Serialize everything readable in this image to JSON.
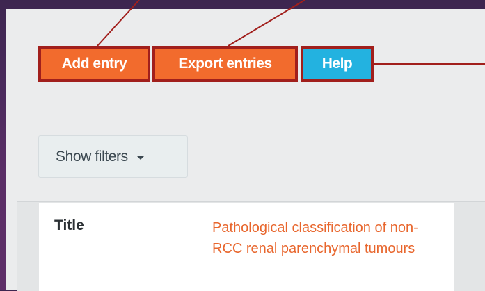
{
  "toolbar": {
    "add_entry_label": "Add entry",
    "export_entries_label": "Export entries",
    "help_label": "Help"
  },
  "filters": {
    "show_filters_label": "Show filters"
  },
  "entry": {
    "title_label": "Title",
    "title_value": "Pathological classification of non-RCC renal parenchymal tumours"
  },
  "colors": {
    "accent_orange": "#f26b2d",
    "accent_blue": "#23b2e0",
    "highlight_border": "#a11f1c",
    "link_orange": "#e8662d"
  }
}
